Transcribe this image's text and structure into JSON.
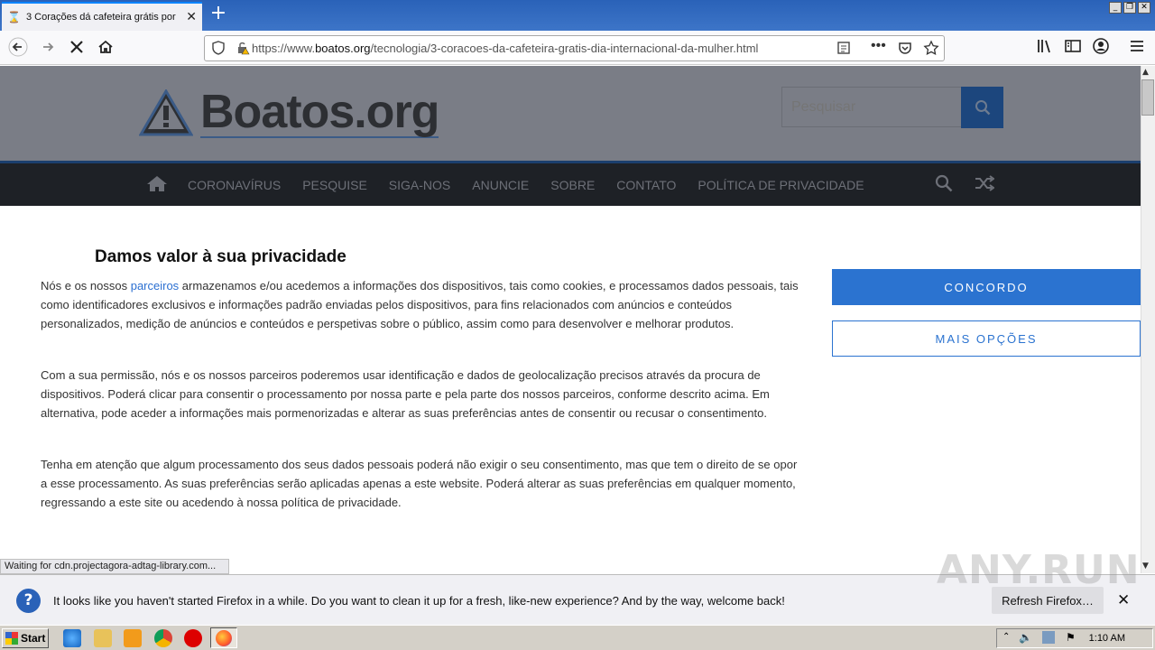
{
  "browser": {
    "tab_title": "3 Corações dá cafeteira grátis por",
    "url_prefix": "https://www.",
    "url_domain": "boatos.org",
    "url_path": "/tecnologia/3-coracoes-da-cafeteira-gratis-dia-internacional-da-mulher.html",
    "status_text": "Waiting for cdn.projectagora-adtag-library.com..."
  },
  "site": {
    "logo_text": "Boatos.org",
    "search_placeholder": "Pesquisar",
    "menu": [
      "CORONAVÍRUS",
      "PESQUISE",
      "SIGA-NOS",
      "ANUNCIE",
      "SOBRE",
      "CONTATO",
      "POLÍTICA DE PRIVACIDADE"
    ]
  },
  "consent": {
    "title": "Damos valor à sua privacidade",
    "p1_before": "Nós e os nossos ",
    "p1_link": "parceiros",
    "p1_after": " armazenamos e/ou acedemos a informações dos dispositivos, tais como cookies, e processamos dados pessoais, tais como identificadores exclusivos e informações padrão enviadas pelos dispositivos, para fins relacionados com anúncios e conteúdos personalizados, medição de anúncios e conteúdos e perspetivas sobre o público, assim como para desenvolver e melhorar produtos.",
    "p2": "Com a sua permissão, nós e os nossos parceiros poderemos usar identificação e dados de geolocalização precisos através da procura de dispositivos. Poderá clicar para consentir o processamento por nossa parte e pela parte dos nossos parceiros, conforme descrito acima. Em alternativa, pode aceder a informações mais pormenorizadas e alterar as suas preferências antes de consentir ou recusar o consentimento.",
    "p3": "Tenha em atenção que algum processamento dos seus dados pessoais poderá não exigir o seu consentimento, mas que tem o direito de se opor a esse processamento. As suas preferências serão aplicadas apenas a este website. Poderá alterar as suas preferências em qualquer momento, regressando a este site ou acedendo à nossa política de privacidade.",
    "agree_label": "CONCORDO",
    "more_label": "MAIS OPÇÕES"
  },
  "notification": {
    "text": "It looks like you haven't started Firefox in a while. Do you want to clean it up for a fresh, like-new experience? And by the way, welcome back!",
    "button": "Refresh Firefox…"
  },
  "watermark": "ANY.RUN",
  "taskbar": {
    "start_label": "Start",
    "clock": "1:10 AM"
  },
  "colors": {
    "accent": "#2b73d0",
    "header_bg": "#7a7d86",
    "menu_bg": "#1e2126"
  }
}
